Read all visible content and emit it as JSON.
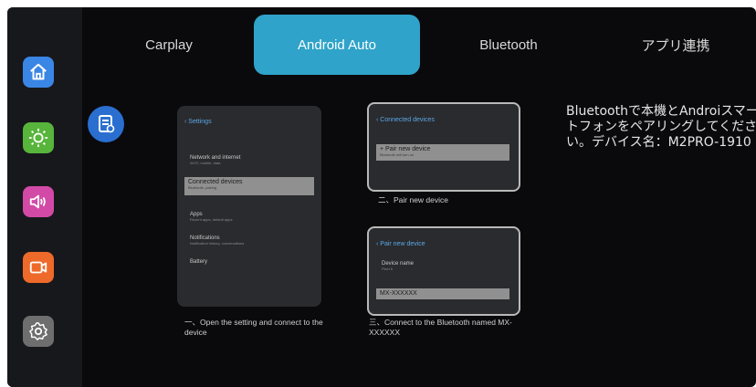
{
  "sidebar": {
    "items": [
      {
        "icon": "home-icon",
        "color": "#3a86e4"
      },
      {
        "icon": "brightness-icon",
        "color": "#57b53b"
      },
      {
        "icon": "volume-icon",
        "color": "#d24aa6"
      },
      {
        "icon": "video-camera-icon",
        "color": "#ee6a2a"
      },
      {
        "icon": "settings-icon",
        "color": "#6e6e6e"
      }
    ]
  },
  "tabs": [
    {
      "label": "Carplay"
    },
    {
      "label": "Android Auto"
    },
    {
      "label": "Bluetooth"
    },
    {
      "label": "アプリ連携"
    }
  ],
  "active_tab": "Android Auto",
  "accent_color": "#2fa3c9",
  "guide": {
    "step1": {
      "screen_title": "‹ Settings",
      "rows": [
        {
          "label": "Network and internet",
          "sub": "Wi-Fi, mobile, data"
        },
        {
          "label": "Connected devices",
          "sub": "Bluetooth, pairing"
        },
        {
          "label": "Apps",
          "sub": "Recent apps, default apps"
        },
        {
          "label": "Notifications",
          "sub": "Notification history, conversations"
        },
        {
          "label": "Battery",
          "sub": ""
        }
      ],
      "caption": "一、Open the setting and connect to the device"
    },
    "step2": {
      "screen_title": "‹ Connected devices",
      "item": "+  Pair new device",
      "item_sub": "Bluetooth will turn on",
      "caption": "二、Pair new device"
    },
    "step3": {
      "screen_title": "‹ Pair new device",
      "row_label": "Device name",
      "row_sub": "Pixel 6",
      "device": "MX-XXXXXX",
      "caption": "三、Connect to the Bluetooth named MX-XXXXXX"
    }
  },
  "info_text": "Bluetoothで本機とAndroiスマートフォンをペアリングしてください。デバイス名：M2PRO-1910"
}
